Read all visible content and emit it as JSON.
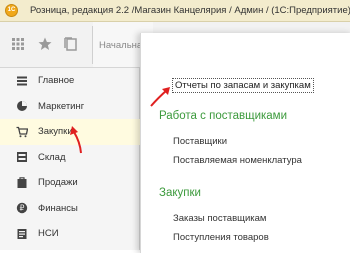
{
  "window": {
    "app_logo": "1C",
    "title": "Розница, редакция 2.2 /Магазин Канцелярия / Админ /  (1С:Предприятие)"
  },
  "toolbar": {
    "icons": [
      "apps-grid-icon",
      "star-icon",
      "history-icon"
    ],
    "home_tab_label": "Начальная страница"
  },
  "sidebar": {
    "items": [
      {
        "label": "Главное",
        "icon": "list-icon"
      },
      {
        "label": "Маркетинг",
        "icon": "pie-chart-icon"
      },
      {
        "label": "Закупки",
        "icon": "cart-icon",
        "active": true
      },
      {
        "label": "Склад",
        "icon": "warehouse-icon"
      },
      {
        "label": "Продажи",
        "icon": "sales-icon"
      },
      {
        "label": "Финансы",
        "icon": "finance-icon"
      },
      {
        "label": "НСИ",
        "icon": "reference-data-icon"
      }
    ]
  },
  "panel": {
    "reports_link": "Отчеты по запасам и закупкам",
    "sections": [
      {
        "title": "Работа с поставщиками",
        "links": [
          "Поставщики",
          "Поставляемая номенклатура"
        ]
      },
      {
        "title": "Закупки",
        "links": [
          "Заказы поставщикам",
          "Поступления товаров"
        ]
      }
    ]
  },
  "colors": {
    "titlebar": "#f3eccd",
    "section_title": "#3c9a3c",
    "annotation_arrow": "#e02020",
    "active_item_bg": "#fffbe0"
  }
}
